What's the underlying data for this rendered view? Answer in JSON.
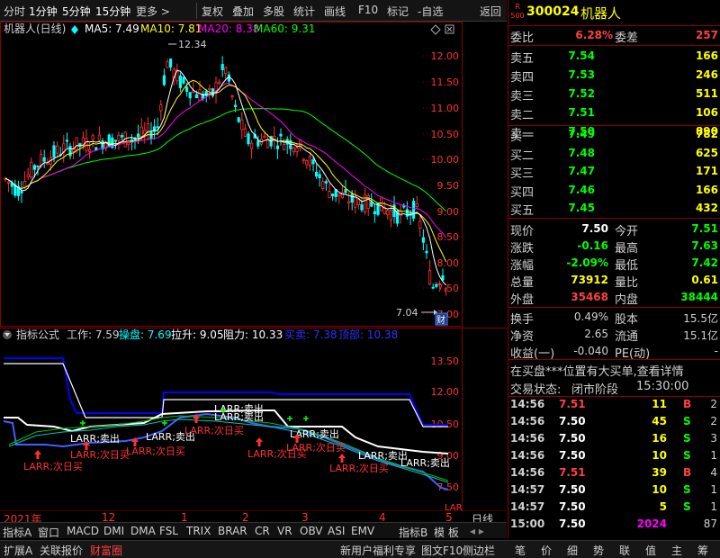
{
  "toolbar": {
    "items": [
      "分时",
      "1分钟",
      "5分钟",
      "15分钟",
      "更多 >",
      "复权",
      "叠加",
      "多股",
      "统计",
      "画线",
      "F10",
      "标记",
      "-自选",
      "返回"
    ]
  },
  "main_chart": {
    "title": "机器人(日线)",
    "ma": [
      {
        "label": "MA5: 7.49",
        "color": "#ffffff"
      },
      {
        "label": "MA10: 7.81",
        "color": "#ffff00"
      },
      {
        "label": "MA20: 8.38",
        "color": "#ff00ff"
      },
      {
        "label": "MA60: 9.31",
        "color": "#00ff00"
      }
    ],
    "price_ticks": [
      "12.00",
      "11.50",
      "11.00",
      "10.50",
      "10.00",
      "9.50",
      "9.00",
      "8.50",
      "8.00",
      "7.50",
      "7.00"
    ],
    "high_label": "12.34",
    "low_label": "7.04",
    "cai_label": "财"
  },
  "indicator": {
    "title": "指标公式",
    "params": [
      {
        "label": "工作: 7.59",
        "color": "#d0d0d0"
      },
      {
        "label": "操盘: 7.69",
        "color": "#00ffff"
      },
      {
        "label": "拉升: 9.05",
        "color": "#ffffff"
      },
      {
        "label": "阻力: 10.33",
        "color": "#ffffff"
      },
      {
        "label": "买卖: 7.38",
        "color": "#3030ff"
      },
      {
        "label": "顶部: 10.38",
        "color": "#3030ff"
      }
    ],
    "ticks": [
      "13.50",
      "12.00",
      "10.50",
      "9.00",
      "7.50"
    ],
    "labels_sell": [
      "LARR;卖出",
      "LARR;卖出",
      "LARR;卖出",
      "LARR;卖出",
      "LARR;卖出",
      "LARR;卖出",
      "LARR;卖出"
    ],
    "labels_buy": [
      "LARR;次日买",
      "LARR;次日买",
      "LARR;次日买",
      "LARR;次日买",
      "LARR;次日买",
      "LARR;次日买",
      "LARR;次日买"
    ],
    "lar_tail": "LAR"
  },
  "x_axis": {
    "labels": [
      "2021年",
      "12",
      "1",
      "2",
      "3",
      "4",
      "5"
    ],
    "right": "日线"
  },
  "bottom_tabs": [
    "指标A",
    "窗口",
    "MACD",
    "DMI",
    "DMA",
    "FSL",
    "TRIX",
    "BRAR",
    "CR",
    "VR",
    "OBV",
    "ASI",
    "EMV",
    "指标B",
    "模 板"
  ],
  "status_bar": {
    "left": [
      "扩展A",
      "关联报价",
      "财富圈"
    ],
    "promo": "新用户福利专享",
    "f10": "图文F10",
    "side": "侧边栏",
    "right": [
      "笔",
      "价",
      "细",
      "势",
      "联",
      "值",
      "主",
      "筹"
    ]
  },
  "quote": {
    "code": "300024",
    "name": "机器人",
    "badge_top": "R",
    "badge_bottom": "500",
    "wei_bi_label": "委比",
    "wei_bi": "6.28%",
    "wei_cha_label": "委差",
    "wei_cha": "257",
    "sells": [
      {
        "label": "卖五",
        "price": "7.54",
        "vol": "166"
      },
      {
        "label": "卖四",
        "price": "7.53",
        "vol": "246"
      },
      {
        "label": "卖三",
        "price": "7.52",
        "vol": "511"
      },
      {
        "label": "卖二",
        "price": "7.51",
        "vol": "106"
      },
      {
        "label": "卖一",
        "price": "7.50",
        "vol": "890"
      }
    ],
    "buys": [
      {
        "label": "买一",
        "price": "7.49",
        "vol": "782"
      },
      {
        "label": "买二",
        "price": "7.48",
        "vol": "625"
      },
      {
        "label": "买三",
        "price": "7.47",
        "vol": "171"
      },
      {
        "label": "买四",
        "price": "7.46",
        "vol": "166"
      },
      {
        "label": "买五",
        "price": "7.45",
        "vol": "432"
      }
    ],
    "stats": [
      {
        "l1": "现价",
        "v1": "7.50",
        "c1": "#ffffff",
        "l2": "今开",
        "v2": "7.51",
        "c2": "#00ff00"
      },
      {
        "l1": "涨跌",
        "v1": "-0.16",
        "c1": "#00ff00",
        "l2": "最高",
        "v2": "7.63",
        "c2": "#00ff00"
      },
      {
        "l1": "涨幅",
        "v1": "-2.09%",
        "c1": "#00ff00",
        "l2": "最低",
        "v2": "7.42",
        "c2": "#00ff00"
      },
      {
        "l1": "总量",
        "v1": "73912",
        "c1": "#ffff00",
        "l2": "量比",
        "v2": "0.61",
        "c2": "#ffff00"
      },
      {
        "l1": "外盘",
        "v1": "35468",
        "c1": "#ff4040",
        "l2": "内盘",
        "v2": "38444",
        "c2": "#00ff00"
      }
    ],
    "stats2": [
      {
        "l1": "换手",
        "v1": "0.49%",
        "l2": "股本",
        "v2": "15.5亿"
      },
      {
        "l1": "净资",
        "v1": "2.65",
        "l2": "流通",
        "v2": "15.1亿"
      },
      {
        "l1": "收益(一)",
        "v1": "-0.040",
        "l2": "PE(动)",
        "v2": "-"
      }
    ],
    "notice": "在买盘***位置有大买单,查看详情",
    "trade_state_label": "交易状态:",
    "trade_state": "闭市阶段",
    "trade_time": "15:30:00",
    "ticks": [
      {
        "time": "14:56",
        "price": "7.51",
        "pc": "#ff4040",
        "vol": "11",
        "vc": "#ffff00",
        "side": "B",
        "sc": "#ff4040",
        "n": "2"
      },
      {
        "time": "14:56",
        "price": "7.50",
        "pc": "#ffffff",
        "vol": "45",
        "vc": "#ffff00",
        "side": "S",
        "sc": "#00ff00",
        "n": "2"
      },
      {
        "time": "14:56",
        "price": "7.50",
        "pc": "#ffffff",
        "vol": "16",
        "vc": "#ffff00",
        "side": "S",
        "sc": "#00ff00",
        "n": "3"
      },
      {
        "time": "14:56",
        "price": "7.50",
        "pc": "#ffffff",
        "vol": "10",
        "vc": "#ffff00",
        "side": "S",
        "sc": "#00ff00",
        "n": "1"
      },
      {
        "time": "14:56",
        "price": "7.51",
        "pc": "#ff4040",
        "vol": "39",
        "vc": "#ffff00",
        "side": "B",
        "sc": "#ff4040",
        "n": "4"
      },
      {
        "time": "14:57",
        "price": "7.50",
        "pc": "#ffffff",
        "vol": "10",
        "vc": "#ffff00",
        "side": "S",
        "sc": "#00ff00",
        "n": "1"
      },
      {
        "time": "14:57",
        "price": "7.50",
        "pc": "#ffffff",
        "vol": "5",
        "vc": "#ffff00",
        "side": "S",
        "sc": "#00ff00",
        "n": "1"
      },
      {
        "time": "15:00",
        "price": "7.50",
        "pc": "#ffffff",
        "vol": "2024",
        "vc": "#ff00ff",
        "side": "",
        "sc": "#ffffff",
        "n": "87"
      }
    ]
  }
}
